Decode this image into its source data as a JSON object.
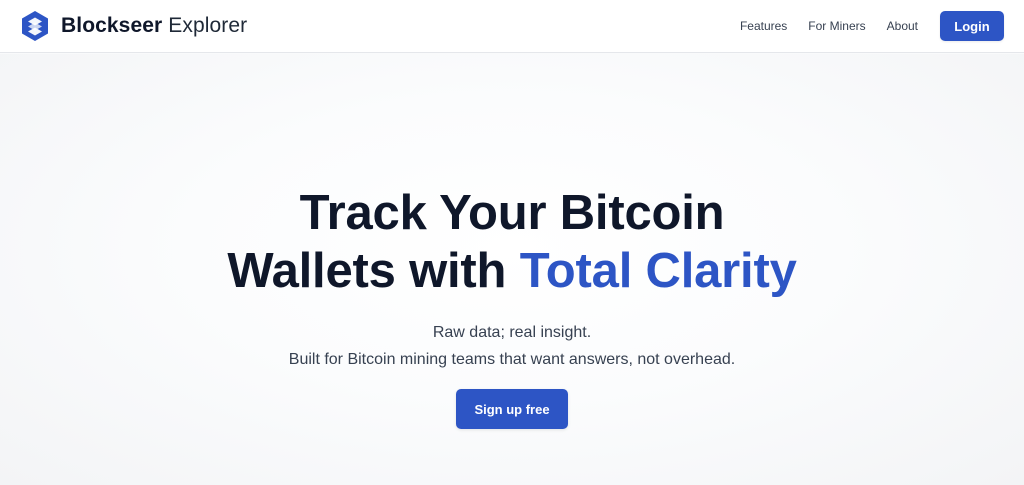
{
  "nav": {
    "brand_bold": "Blockseer",
    "brand_light": "Explorer",
    "links": [
      "Features",
      "For Miners",
      "About"
    ],
    "login_label": "Login"
  },
  "hero": {
    "title_line1": "Track Your Bitcoin",
    "title_line2_plain": "Wallets with",
    "title_line2_accent": "Total Clarity",
    "subtitle_line1": "Raw data; real insight.",
    "subtitle_line2": "Built for Bitcoin mining teams that want answers, not overhead.",
    "cta_label": "Sign up free"
  },
  "colors": {
    "accent": "#2d55c5",
    "text_dark": "#0f172a",
    "text_muted": "#374151"
  },
  "icons": {
    "brand_logo": "blockseer-logo-icon"
  }
}
